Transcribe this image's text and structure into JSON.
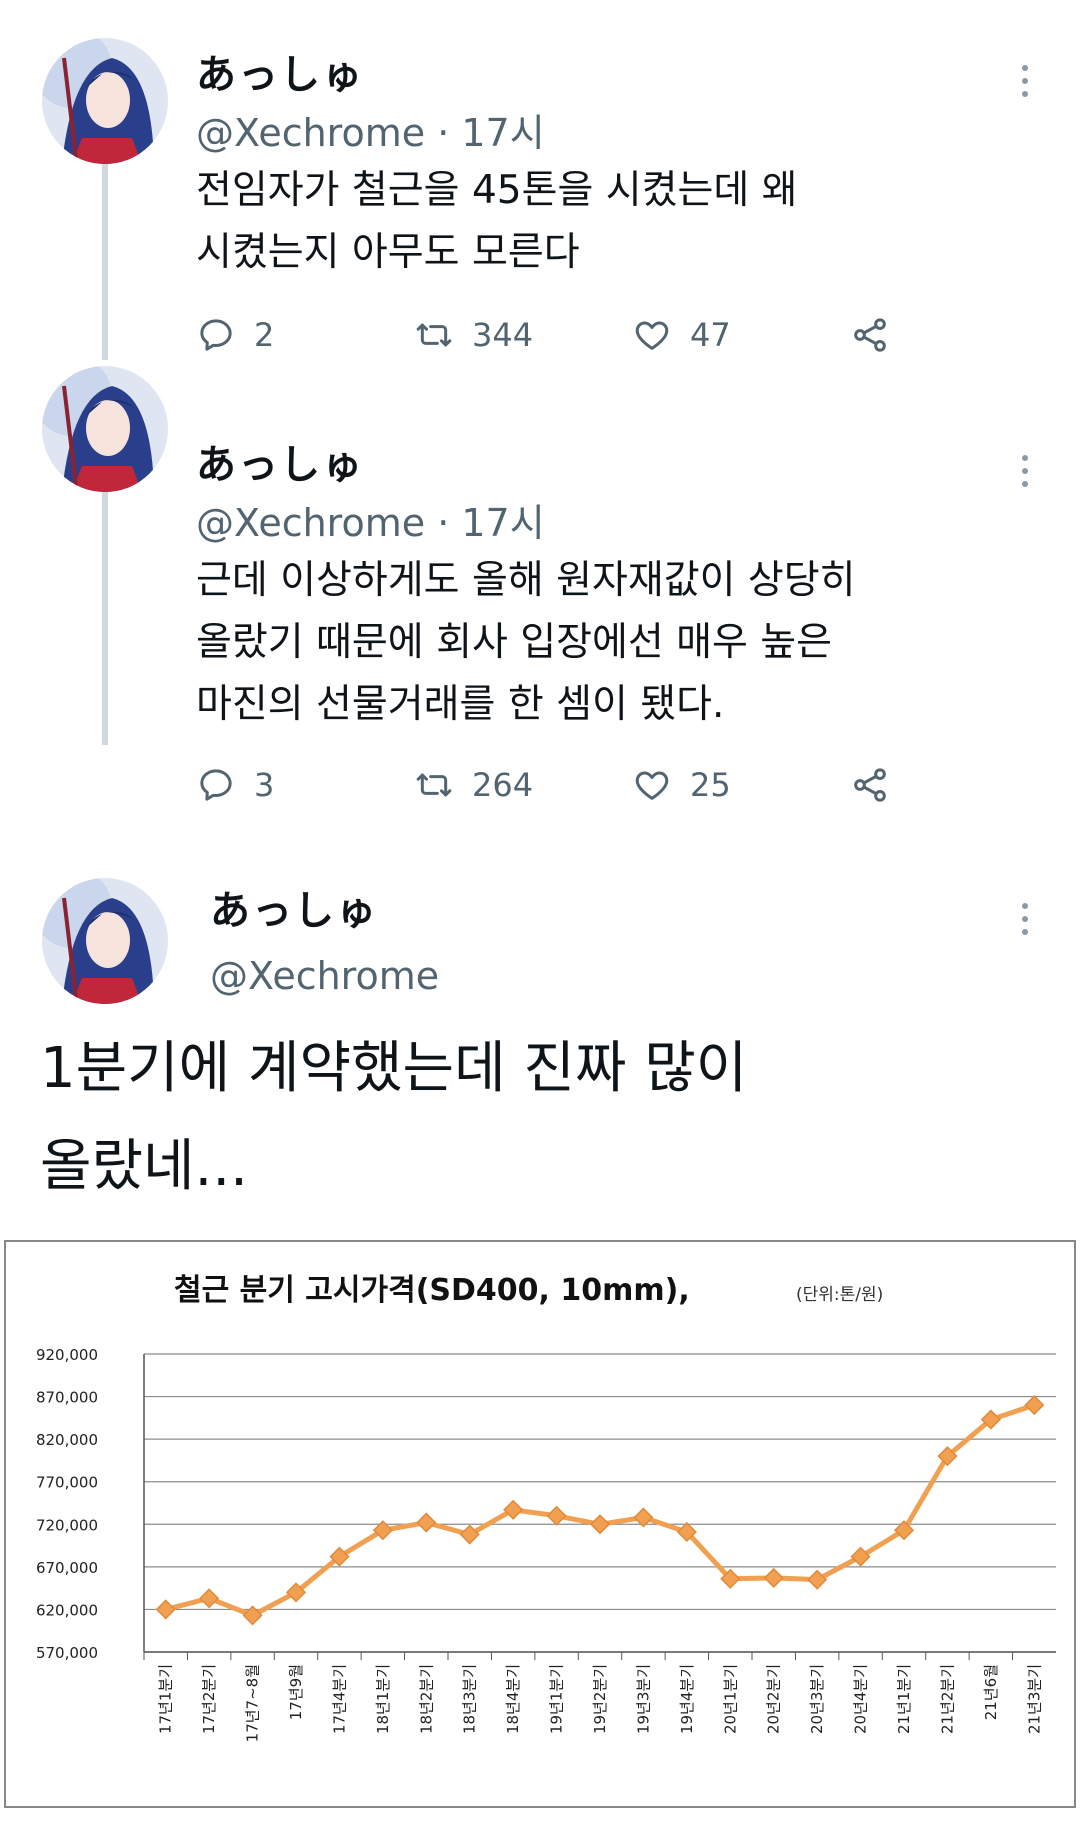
{
  "tweets": [
    {
      "name": "あっしゅ",
      "handle": "@Xechrome · 17시",
      "text": "전임자가 철근을 45톤을 시켰는데 왜\n시켰는지 아무도 모른다",
      "replies": "2",
      "retweets": "344",
      "likes": "47"
    },
    {
      "name": "あっしゅ",
      "handle": "@Xechrome · 17시",
      "text": "근데 이상하게도 올해 원자재값이 상당히\n올랐기 때문에 회사 입장에선 매우 높은\n마진의 선물거래를 한 셈이 됐다.",
      "replies": "3",
      "retweets": "264",
      "likes": "25"
    },
    {
      "name": "あっしゅ",
      "handle": "@Xechrome",
      "text": "1분기에 계약했는데 진짜 많이\n올랐네..."
    }
  ],
  "icons": {
    "reply": "reply-icon",
    "retweet": "retweet-icon",
    "like": "heart-icon",
    "share": "share-icon",
    "more": "more-vertical-icon"
  },
  "colors": {
    "text": "#0f1419",
    "secondary": "#536471",
    "thread_line": "#cfd9de",
    "series": "#f0a050",
    "series_edge": "#e08a3a"
  },
  "chart_data": {
    "type": "line",
    "title": "철근 분기 고시가격(SD400, 10mm),",
    "subtitle": "(단위:톤/원)",
    "categories": [
      "17년1분기",
      "17년2분기",
      "17년7~8월",
      "17년9월",
      "17년4분기",
      "18년1분기",
      "18년2분기",
      "18년3분기",
      "18년4분기",
      "19년1분기",
      "19년2분기",
      "19년3분기",
      "19년4분기",
      "20년1분기",
      "20년2분기",
      "20년3분기",
      "20년4분기",
      "21년1분기",
      "21년2분기",
      "21년6월",
      "21년3분기"
    ],
    "values": [
      620000,
      633000,
      613000,
      640000,
      682000,
      713000,
      722000,
      708000,
      737000,
      730000,
      720000,
      728000,
      711000,
      656000,
      657000,
      655000,
      682000,
      713000,
      800000,
      843000,
      860000
    ],
    "yticks": [
      "920,000",
      "870,000",
      "820,000",
      "770,000",
      "720,000",
      "670,000",
      "620,000",
      "570,000"
    ],
    "ylim": [
      570000,
      920000
    ],
    "grid": true
  }
}
